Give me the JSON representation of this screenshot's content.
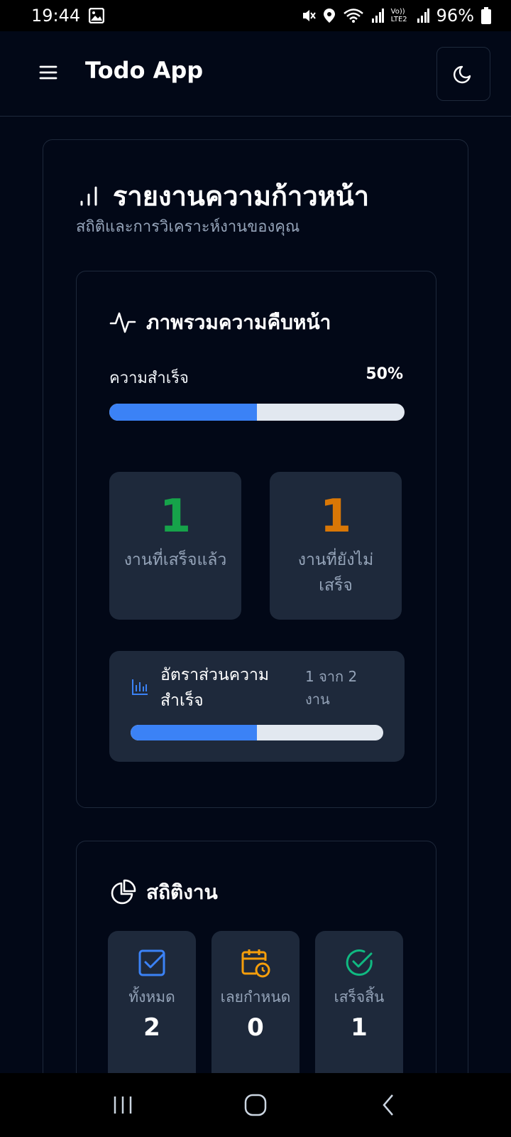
{
  "status_bar": {
    "time": "19:44",
    "battery": "96%",
    "network_label": "Vo)) LTE2",
    "icons": [
      "image-icon",
      "mute-icon",
      "location-icon",
      "wifi-icon",
      "signal-icon",
      "battery-icon"
    ]
  },
  "header": {
    "title": "Todo App",
    "menu_icon": "hamburger-icon",
    "theme_icon": "moon-icon"
  },
  "report": {
    "title": "รายงานความก้าวหน้า",
    "subtitle": "สถิติและการวิเคราะห์งานของคุณ",
    "icon": "bar-signal-icon"
  },
  "overview": {
    "title": "ภาพรวมความคืบหน้า",
    "icon": "activity-icon",
    "success_label": "ความสำเร็จ",
    "success_value": "50%",
    "progress_fraction": 0.5,
    "completed_count": "1",
    "completed_label": "งานที่เสร็จแล้ว",
    "pending_count": "1",
    "pending_label": "งานที่ยังไม่เสร็จ",
    "ratio_title": "อัตราส่วนความสำเร็จ",
    "ratio_count": "1 จาก 2 งาน",
    "ratio_fraction": 0.5
  },
  "stats": {
    "title": "สถิติงาน",
    "icon": "pie-chart-icon",
    "tiles": [
      {
        "label": "ทั้งหมด",
        "value": "2",
        "icon": "checkbox-icon",
        "color": "#3b82f6"
      },
      {
        "label": "เลยกำหนด",
        "value": "0",
        "icon": "calendar-clock-icon",
        "color": "#f59e0b"
      },
      {
        "label": "เสร็จสิ้น",
        "value": "1",
        "icon": "check-circle-icon",
        "color": "#10b981"
      }
    ]
  },
  "colors": {
    "background": "#020817",
    "card": "#1e293b",
    "accent": "#3b82f6",
    "completed": "#16a34a",
    "pending": "#d97706"
  }
}
